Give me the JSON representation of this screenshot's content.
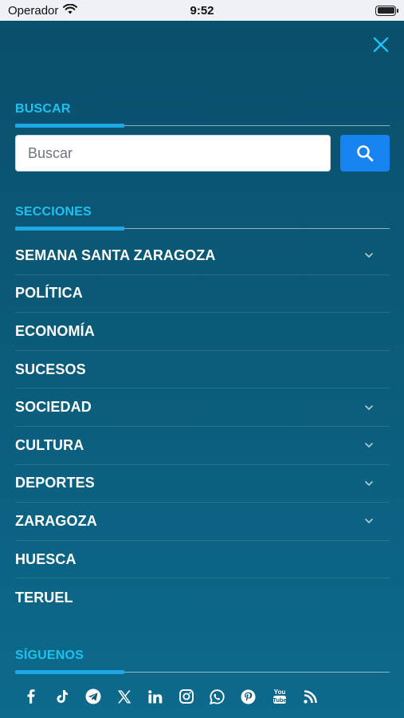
{
  "status_bar": {
    "carrier": "Operador",
    "time": "9:52"
  },
  "menu": {
    "search_section": {
      "title": "BUSCAR",
      "placeholder": "Buscar"
    },
    "sections_section": {
      "title": "SECCIONES",
      "items": [
        {
          "label": "SEMANA SANTA ZARAGOZA",
          "expandable": true
        },
        {
          "label": "POLÍTICA",
          "expandable": false
        },
        {
          "label": "ECONOMÍA",
          "expandable": false
        },
        {
          "label": "SUCESOS",
          "expandable": false
        },
        {
          "label": "SOCIEDAD",
          "expandable": true
        },
        {
          "label": "CULTURA",
          "expandable": true
        },
        {
          "label": "DEPORTES",
          "expandable": true
        },
        {
          "label": "ZARAGOZA",
          "expandable": true
        },
        {
          "label": "HUESCA",
          "expandable": false
        },
        {
          "label": "TERUEL",
          "expandable": false
        }
      ]
    },
    "follow_section": {
      "title": "SÍGUENOS",
      "social_icons": [
        "facebook-icon",
        "tiktok-icon",
        "telegram-icon",
        "x-icon",
        "linkedin-icon",
        "instagram-icon",
        "whatsapp-icon",
        "pinterest-icon",
        "youtube-icon",
        "rss-icon"
      ]
    }
  },
  "colors": {
    "accent": "#1ec1f0",
    "search_button": "#1683f0",
    "background_top": "#0a4f6b",
    "background_bottom": "#0d6a8c"
  }
}
